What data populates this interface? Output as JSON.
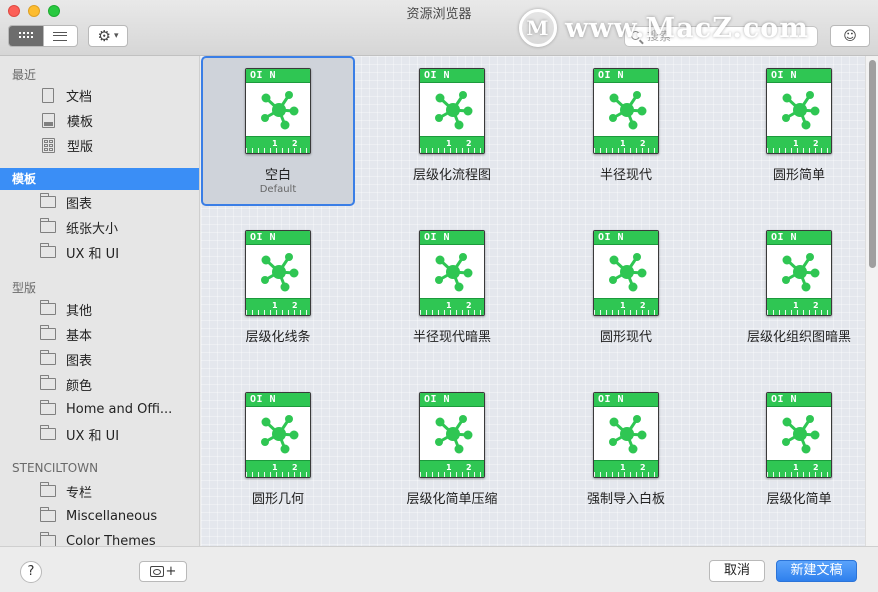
{
  "window": {
    "title": "资源浏览器"
  },
  "toolbar": {
    "search_placeholder": "搜索",
    "view_modes": [
      "grid-view",
      "list-view"
    ],
    "active_view": "grid-view"
  },
  "watermark": {
    "logo_letter": "M",
    "text": "www.MacZ.com"
  },
  "sidebar": {
    "sections": [
      {
        "header": "最近",
        "items": [
          {
            "label": "文档",
            "icon": "document-icon"
          },
          {
            "label": "模板",
            "icon": "template-icon"
          },
          {
            "label": "型版",
            "icon": "stencil-icon"
          }
        ]
      },
      {
        "header": "模板",
        "selected": true,
        "items": [
          {
            "label": "图表",
            "icon": "folder-icon"
          },
          {
            "label": "纸张大小",
            "icon": "folder-icon"
          },
          {
            "label": "UX 和 UI",
            "icon": "folder-icon"
          }
        ]
      },
      {
        "header": "型版",
        "items": [
          {
            "label": "其他",
            "icon": "folder-icon"
          },
          {
            "label": "基本",
            "icon": "folder-icon"
          },
          {
            "label": "图表",
            "icon": "folder-icon"
          },
          {
            "label": "颜色",
            "icon": "folder-icon"
          },
          {
            "label": "Home and Offi...",
            "icon": "folder-icon"
          },
          {
            "label": "UX 和 UI",
            "icon": "folder-icon"
          }
        ]
      },
      {
        "header": "STENCILTOWN",
        "items": [
          {
            "label": "专栏",
            "icon": "folder-icon"
          },
          {
            "label": "Miscellaneous",
            "icon": "folder-icon"
          },
          {
            "label": "Color Themes",
            "icon": "folder-icon"
          }
        ]
      }
    ]
  },
  "templates": [
    {
      "label": "空白",
      "sublabel": "Default",
      "selected": true
    },
    {
      "label": "层级化流程图"
    },
    {
      "label": "半径现代"
    },
    {
      "label": "圆形简单"
    },
    {
      "label": "层级化线条"
    },
    {
      "label": "半径现代暗黑"
    },
    {
      "label": "圆形现代"
    },
    {
      "label": "层级化组织图暗黑"
    },
    {
      "label": "圆形几何"
    },
    {
      "label": "层级化简单压缩"
    },
    {
      "label": "强制导入白板"
    },
    {
      "label": "层级化简单"
    }
  ],
  "doc_icon": {
    "badge_text": "OI N",
    "ruler_1": "1",
    "ruler_2": "2",
    "accent_color": "#2fc653"
  },
  "footer": {
    "help_label": "?",
    "add_label": "+",
    "cancel_label": "取消",
    "create_label": "新建文稿"
  },
  "colors": {
    "selection": "#3a8ef6",
    "primary_button": "#2f80ed",
    "omni_green": "#2fc653"
  }
}
